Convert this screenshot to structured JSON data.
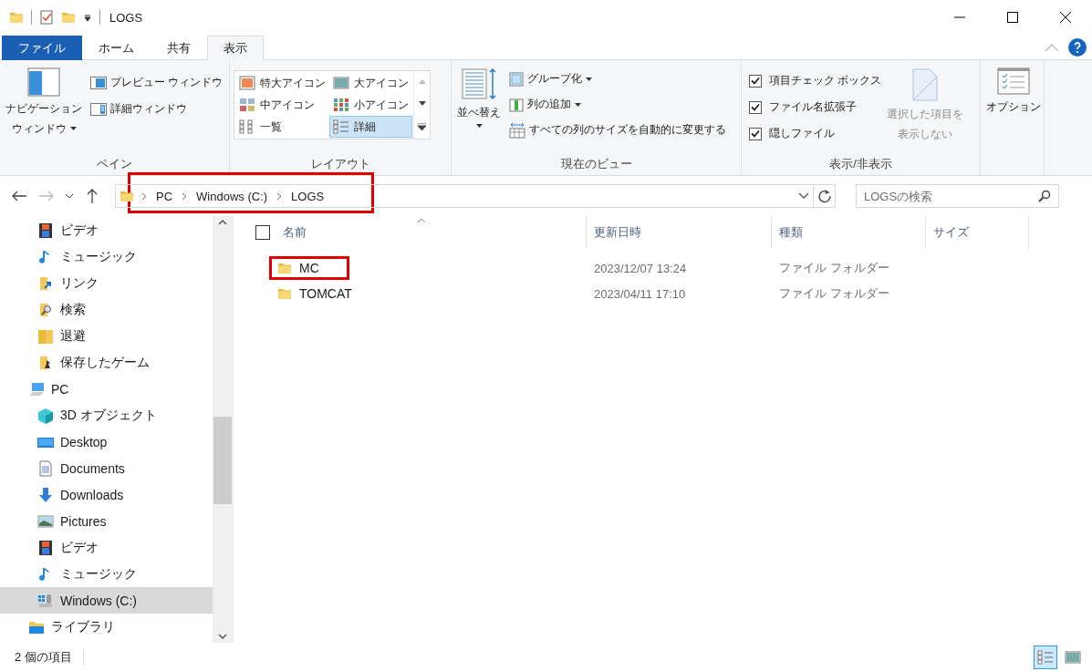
{
  "window": {
    "title": "LOGS"
  },
  "ribbon_tabs": [
    {
      "label": "ファイル",
      "kind": "file",
      "selected": false
    },
    {
      "label": "ホーム",
      "kind": "tab",
      "selected": false
    },
    {
      "label": "共有",
      "kind": "tab",
      "selected": false
    },
    {
      "label": "表示",
      "kind": "tab",
      "selected": true
    }
  ],
  "pane_group": {
    "label": "ペイン",
    "navigation_pane": [
      "ナビゲーション",
      "ウィンドウ"
    ],
    "buttons": [
      {
        "label": "プレビュー ウィンドウ",
        "kind": "preview"
      },
      {
        "label": "詳細ウィンドウ",
        "kind": "details"
      }
    ]
  },
  "layout_group": {
    "label": "レイアウト",
    "options": [
      {
        "label": "特大アイコン",
        "kind": "xl",
        "selected": false
      },
      {
        "label": "大アイコン",
        "kind": "large",
        "selected": false
      },
      {
        "label": "中アイコン",
        "kind": "medium",
        "selected": false
      },
      {
        "label": "小アイコン",
        "kind": "small",
        "selected": false
      },
      {
        "label": "一覧",
        "kind": "list",
        "selected": false
      },
      {
        "label": "詳細",
        "kind": "details",
        "selected": true
      }
    ]
  },
  "current_view_group": {
    "label": "現在のビュー",
    "sort": "並べ替え",
    "buttons": [
      {
        "label": "グループ化",
        "kind": "group",
        "dropdown": true
      },
      {
        "label": "列の追加",
        "kind": "add-column",
        "dropdown": true
      },
      {
        "label": "すべての列のサイズを自動的に変更する",
        "kind": "autosize",
        "dropdown": false
      }
    ]
  },
  "show_hide_group": {
    "label": "表示/非表示",
    "checkboxes": [
      {
        "label": "項目チェック ボックス",
        "checked": true
      },
      {
        "label": "ファイル名拡張子",
        "checked": true
      },
      {
        "label": "隠しファイル",
        "checked": true
      }
    ],
    "hide_selected": {
      "lines": [
        "選択した項目を",
        "表示しない"
      ],
      "disabled": true
    }
  },
  "options_button": "オプション",
  "navigation": {
    "path": [
      "PC",
      "Windows (C:)",
      "LOGS"
    ],
    "highlighted": true,
    "search_placeholder": "LOGSの検索"
  },
  "sidebar": {
    "tree": [
      {
        "children": [
          {
            "label": "ビデオ",
            "kind": "video",
            "selected": false
          },
          {
            "label": "ミュージック",
            "kind": "music",
            "selected": false
          },
          {
            "label": "リンク",
            "kind": "link",
            "selected": false
          },
          {
            "label": "検索",
            "kind": "search",
            "selected": false
          },
          {
            "label": "退避",
            "kind": "folder",
            "selected": false
          },
          {
            "label": "保存したゲーム",
            "kind": "games",
            "selected": false
          }
        ]
      },
      {
        "label": "PC",
        "kind": "pc",
        "selected": false,
        "children": [
          {
            "label": "3D オブジェクト",
            "kind": "cube",
            "selected": false
          },
          {
            "label": "Desktop",
            "kind": "desktop",
            "selected": false
          },
          {
            "label": "Documents",
            "kind": "documents",
            "selected": false
          },
          {
            "label": "Downloads",
            "kind": "downloads",
            "selected": false
          },
          {
            "label": "Pictures",
            "kind": "pictures",
            "selected": false
          },
          {
            "label": "ビデオ",
            "kind": "video",
            "selected": false
          },
          {
            "label": "ミュージック",
            "kind": "music",
            "selected": false
          },
          {
            "label": "Windows (C:)",
            "kind": "drive",
            "selected": true
          }
        ]
      },
      {
        "label": "ライブラリ",
        "kind": "library",
        "selected": false
      }
    ]
  },
  "file_list": {
    "columns": [
      {
        "label": "名前",
        "sorted": true
      },
      {
        "label": "更新日時",
        "sorted": false
      },
      {
        "label": "種類",
        "sorted": false
      },
      {
        "label": "サイズ",
        "sorted": false
      }
    ],
    "rows": [
      {
        "name": "MC",
        "modified": "2023/12/07 13:24",
        "type": "ファイル フォルダー",
        "highlighted": true
      },
      {
        "name": "TOMCAT",
        "modified": "2023/04/11 17:10",
        "type": "ファイル フォルダー",
        "highlighted": false
      }
    ]
  },
  "status_bar": {
    "item_count": "2 個の項目",
    "view_buttons": [
      {
        "kind": "details",
        "selected": true
      },
      {
        "kind": "large",
        "selected": false
      }
    ]
  }
}
